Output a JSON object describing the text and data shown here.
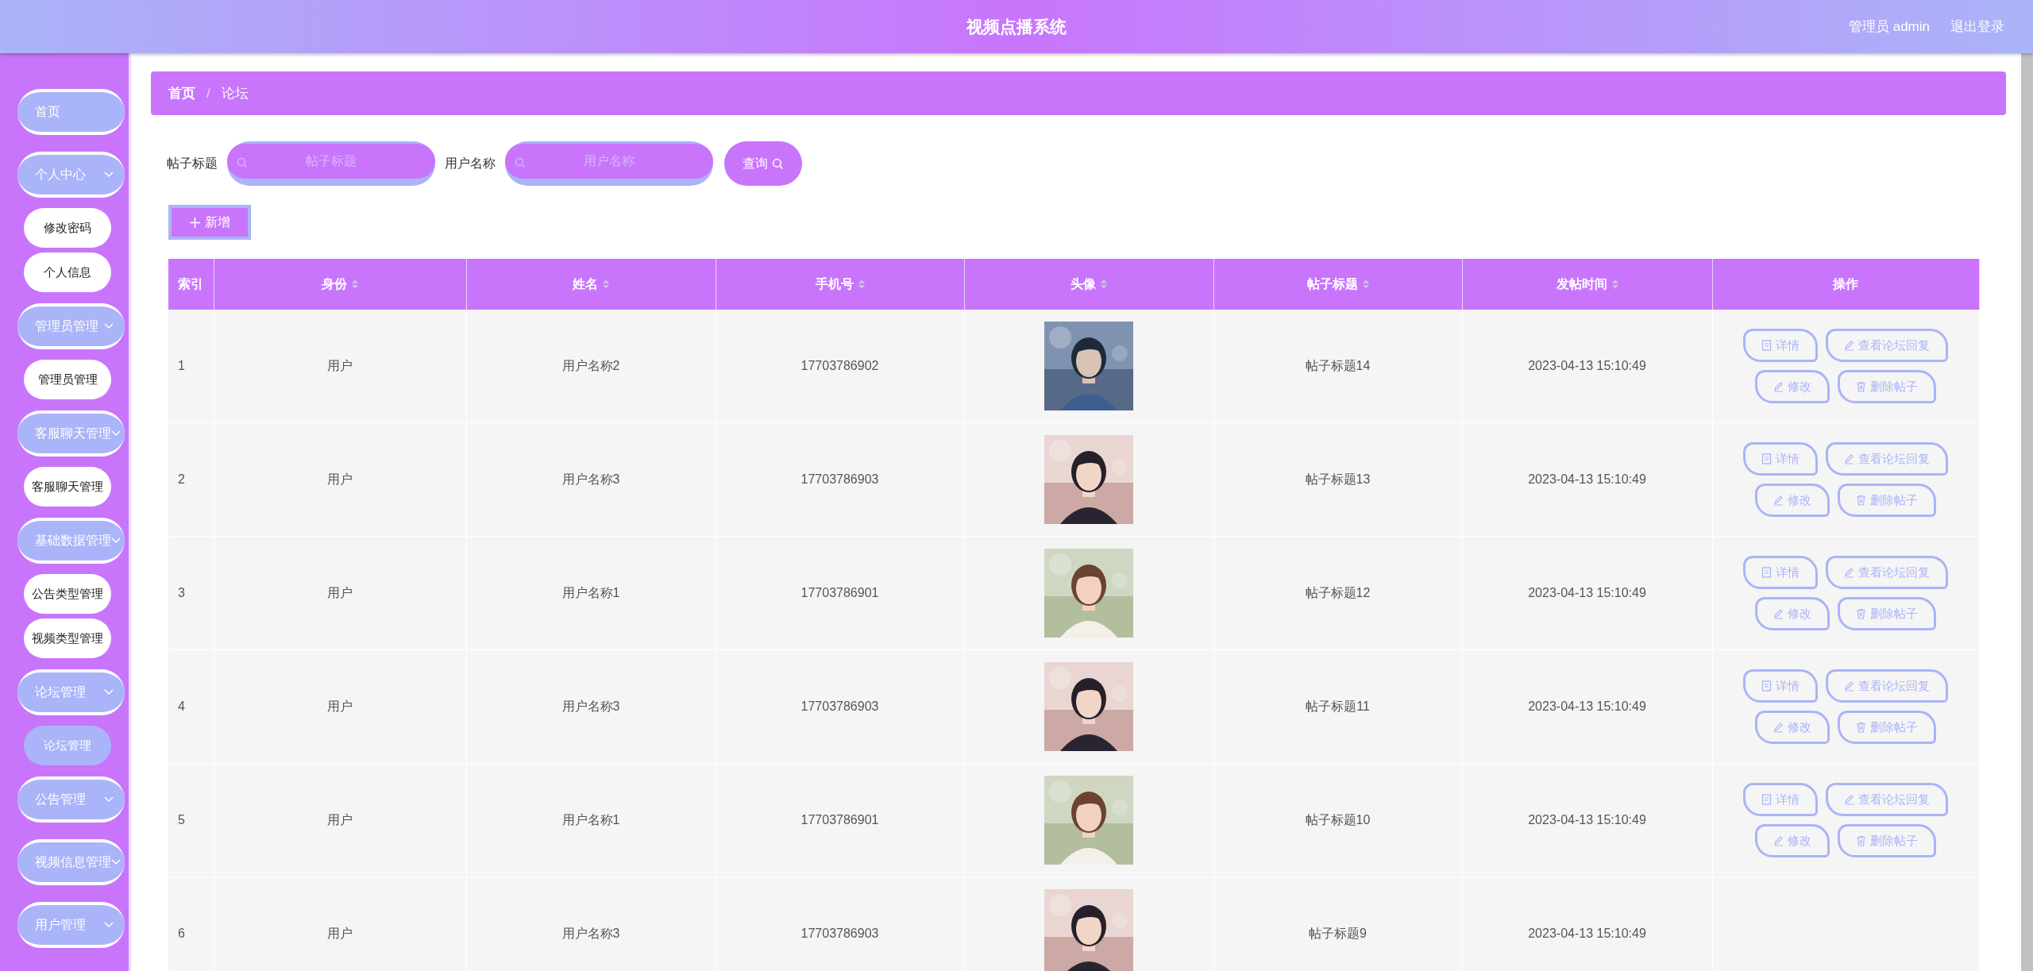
{
  "header": {
    "title": "视频点播系统",
    "user": "管理员 admin",
    "logout": "退出登录"
  },
  "sidebar": {
    "items": [
      {
        "label": "首页",
        "kind": "link"
      },
      {
        "label": "个人中心",
        "kind": "group",
        "children": [
          {
            "label": "修改密码",
            "selected": false
          },
          {
            "label": "个人信息",
            "selected": false
          }
        ]
      },
      {
        "label": "管理员管理",
        "kind": "group",
        "children": [
          {
            "label": "管理员管理",
            "selected": false
          }
        ]
      },
      {
        "label": "客服聊天管理",
        "kind": "group",
        "children": [
          {
            "label": "客服聊天管理",
            "selected": false
          }
        ]
      },
      {
        "label": "基础数据管理",
        "kind": "group",
        "children": [
          {
            "label": "公告类型管理",
            "selected": false
          },
          {
            "label": "视频类型管理",
            "selected": false
          }
        ]
      },
      {
        "label": "论坛管理",
        "kind": "group",
        "children": [
          {
            "label": "论坛管理",
            "selected": true
          }
        ]
      },
      {
        "label": "公告管理",
        "kind": "group"
      },
      {
        "label": "视频信息管理",
        "kind": "group"
      },
      {
        "label": "用户管理",
        "kind": "group"
      }
    ]
  },
  "breadcrumb": {
    "items": [
      "首页",
      "论坛"
    ],
    "separator": "/"
  },
  "search": {
    "fields": [
      {
        "label": "帖子标题",
        "placeholder": "帖子标题"
      },
      {
        "label": "用户名称",
        "placeholder": "用户名称"
      }
    ],
    "button": "查询"
  },
  "add_button": "新增",
  "table": {
    "columns": [
      {
        "label": "索引",
        "sortable": false
      },
      {
        "label": "身份",
        "sortable": true
      },
      {
        "label": "姓名",
        "sortable": true
      },
      {
        "label": "手机号",
        "sortable": true
      },
      {
        "label": "头像",
        "sortable": true
      },
      {
        "label": "帖子标题",
        "sortable": true
      },
      {
        "label": "发帖时间",
        "sortable": true
      },
      {
        "label": "操作",
        "sortable": false
      }
    ],
    "rows": [
      {
        "index": "1",
        "role": "用户",
        "name": "用户名称2",
        "phone": "17703786902",
        "title": "帖子标题14",
        "time": "2023-04-13 15:10:49",
        "actions": [
          {
            "label": "详情",
            "kind": "detail"
          },
          {
            "label": "查看论坛回复",
            "kind": "edit"
          },
          {
            "label": "修改",
            "kind": "edit"
          },
          {
            "label": "删除帖子",
            "kind": "delete"
          }
        ]
      },
      {
        "index": "2",
        "role": "用户",
        "name": "用户名称3",
        "phone": "17703786903",
        "title": "帖子标题13",
        "time": "2023-04-13 15:10:49",
        "actions": [
          {
            "label": "详情",
            "kind": "detail"
          },
          {
            "label": "查看论坛回复",
            "kind": "edit"
          },
          {
            "label": "修改",
            "kind": "edit"
          },
          {
            "label": "删除帖子",
            "kind": "delete"
          }
        ]
      },
      {
        "index": "3",
        "role": "用户",
        "name": "用户名称1",
        "phone": "17703786901",
        "title": "帖子标题12",
        "time": "2023-04-13 15:10:49",
        "actions": [
          {
            "label": "详情",
            "kind": "detail"
          },
          {
            "label": "查看论坛回复",
            "kind": "edit"
          },
          {
            "label": "修改",
            "kind": "edit"
          },
          {
            "label": "删除帖子",
            "kind": "delete"
          }
        ]
      },
      {
        "index": "4",
        "role": "用户",
        "name": "用户名称3",
        "phone": "17703786903",
        "title": "帖子标题11",
        "time": "2023-04-13 15:10:49",
        "actions": [
          {
            "label": "详情",
            "kind": "detail"
          },
          {
            "label": "查看论坛回复",
            "kind": "edit"
          },
          {
            "label": "修改",
            "kind": "edit"
          },
          {
            "label": "删除帖子",
            "kind": "delete"
          }
        ]
      },
      {
        "index": "5",
        "role": "用户",
        "name": "用户名称1",
        "phone": "17703786901",
        "title": "帖子标题10",
        "time": "2023-04-13 15:10:49",
        "actions": [
          {
            "label": "详情",
            "kind": "detail"
          },
          {
            "label": "查看论坛回复",
            "kind": "edit"
          },
          {
            "label": "修改",
            "kind": "edit"
          },
          {
            "label": "删除帖子",
            "kind": "delete"
          }
        ]
      },
      {
        "index": "6",
        "role": "用户",
        "name": "用户名称3",
        "phone": "17703786903",
        "title": "帖子标题9",
        "time": "2023-04-13 15:10:49"
      }
    ]
  }
}
